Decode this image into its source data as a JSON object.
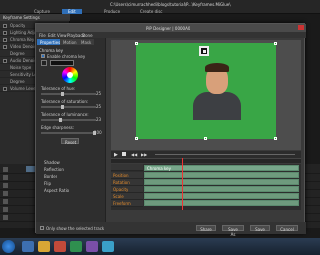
{
  "app": {
    "title": "C:\\Users\\cimurrachhedi\\blogs\\tutorial\\P...\\Keyframes.MiGlue\\",
    "tabs": [
      "Capture",
      "Edit",
      "Produce",
      "Create disc"
    ],
    "active_tab": "Edit"
  },
  "left_panel": {
    "title": "Keyframe Settings",
    "sections": [
      "Opacity",
      "Lighting Adjustment",
      "Chroma Key",
      "Video Denoise",
      "Degree",
      "Audio Denoise",
      "Noise type",
      "Sensitivity Level",
      "Degree",
      "Volume Level"
    ]
  },
  "dialog": {
    "title": "PiP Designer | 0000A0",
    "menu": [
      "File",
      "Edit",
      "View",
      "Playback",
      "Done"
    ],
    "subtabs": [
      "Properties",
      "Motion",
      "Mask"
    ],
    "chroma_key_label": "Chroma key",
    "enable_label": "Enable chroma key",
    "tolerance_hue": "Tolerance of hue:",
    "tolerance_hue_val": "25",
    "tolerance_sat": "Tolerance of saturation:",
    "tolerance_sat_val": "25",
    "tolerance_lum": "Tolerance of luminance:",
    "tolerance_lum_val": "23",
    "edge_sharpness": "Edge sharpness:",
    "edge_sharpness_val": "100",
    "reset_label": "Reset",
    "options": [
      "Shadow",
      "Reflection",
      "Border",
      "Flip",
      "Aspect Ratio"
    ],
    "show_selected": "Only show the selected track",
    "timeline_rows": [
      "Position",
      "Rotation",
      "Opacity",
      "Scale",
      "Freeform"
    ],
    "clip_label": "Chroma key",
    "buttons": [
      "Share",
      "Save As",
      "Save",
      "Cancel"
    ],
    "colors": {
      "green_screen": "#39a646",
      "accent": "#2f6fb8",
      "clip": "#77a68a"
    }
  }
}
